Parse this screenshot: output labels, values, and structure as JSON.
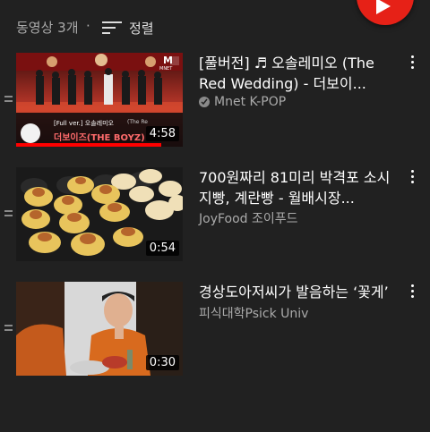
{
  "header": {
    "video_count": "동영상 3개",
    "separator": "·",
    "sort_label": "정렬",
    "sort_icon": "sort-icon",
    "fab_icon": "play-icon"
  },
  "colors": {
    "background": "#212121",
    "accent": "#e62117",
    "progress": "#ff0000"
  },
  "videos": [
    {
      "title_line1": "[풀버전] ♬ 오솔레미오 (The",
      "title_line2": "Red Wedding) - 더보이...",
      "channel": "Mnet K-POP",
      "verified": true,
      "duration": "4:58",
      "watched_progress": 0.87,
      "thumb_caption_top": "[Full ver.] 오솔레미오",
      "thumb_caption_top2": "(The Re",
      "thumb_caption_main": "더보이즈(THE BOYZ)",
      "thumb_logo": "M",
      "thumb_logo_sub": "MNET"
    },
    {
      "title_line1": "700원짜리 81미리 박격포 소시",
      "title_line2": "지빵, 계란빵 - 월배시장...",
      "channel": "JoyFood 조이푸드",
      "verified": false,
      "duration": "0:54"
    },
    {
      "title_line1": "경상도아저씨가 발음하는 ‘꽃게’",
      "title_line2": "",
      "channel": "피식대학Psick Univ",
      "verified": false,
      "duration": "0:30"
    }
  ]
}
